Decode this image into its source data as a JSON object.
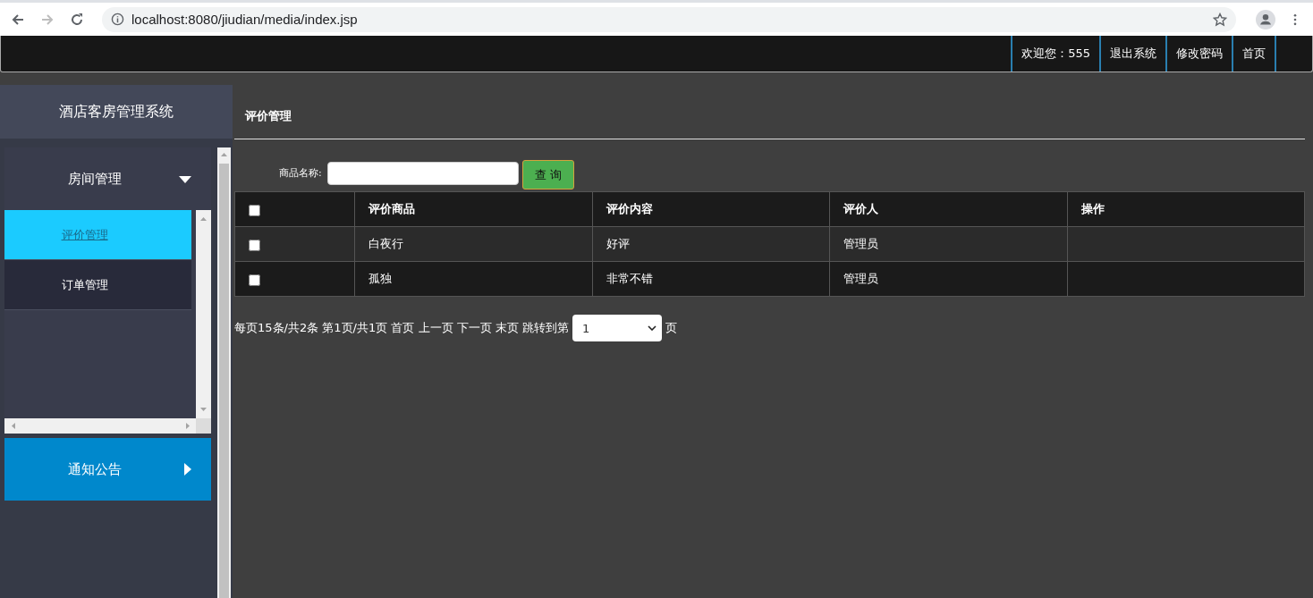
{
  "browser": {
    "url": "localhost:8080/jiudian/media/index.jsp"
  },
  "header": {
    "links": [
      {
        "label": "欢迎您：555"
      },
      {
        "label": "退出系统"
      },
      {
        "label": "修改密码"
      },
      {
        "label": "首页"
      }
    ]
  },
  "sidebar": {
    "title": "酒店客房管理系统",
    "menus": [
      {
        "label": "房间管理",
        "expanded": true,
        "items": [
          {
            "label": "评价管理",
            "selected": true
          },
          {
            "label": "订单管理",
            "selected": false
          }
        ]
      },
      {
        "label": "通知公告",
        "expanded": false
      }
    ]
  },
  "main": {
    "title": "评价管理",
    "search": {
      "label": "商品名称:",
      "button": "查 询"
    },
    "table": {
      "header_checked": false,
      "columns": [
        "评价商品",
        "评价内容",
        "评价人",
        "操作"
      ],
      "rows": [
        {
          "checked": false,
          "cells": [
            "白夜行",
            "好评",
            "管理员",
            ""
          ]
        },
        {
          "checked": false,
          "cells": [
            "孤独",
            "非常不错",
            "管理员",
            ""
          ]
        }
      ]
    },
    "pagination": {
      "text": "每页15条/共2条 第1页/共1页 首页 上一页 下一页 末页 跳转到第",
      "page": "1",
      "suffix": "页"
    }
  }
}
